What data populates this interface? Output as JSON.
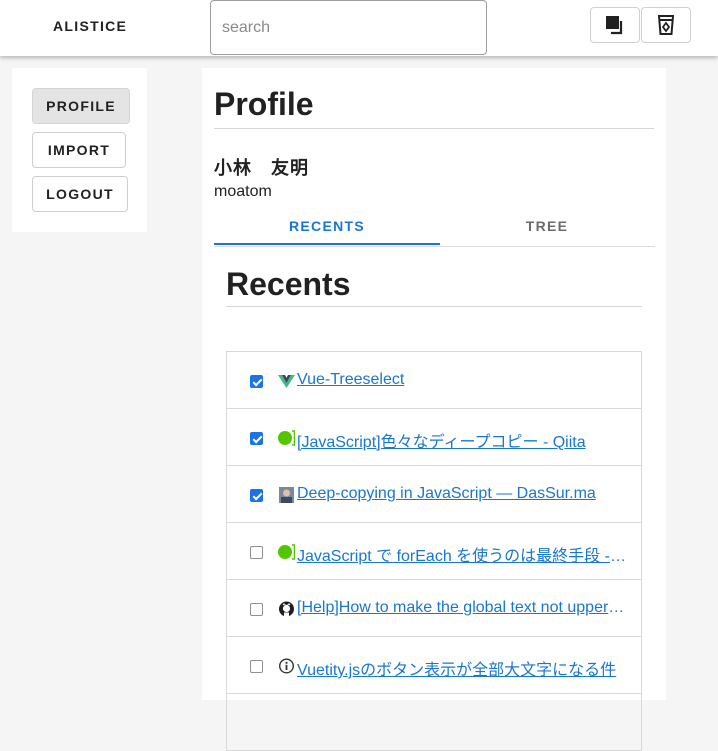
{
  "header": {
    "brand": "ALISTICE",
    "search": {
      "placeholder": "search",
      "value": ""
    },
    "buttons": [
      {
        "icon": "copy-icon"
      },
      {
        "icon": "trash-icon"
      }
    ]
  },
  "sidebar": {
    "items": [
      {
        "label": "PROFILE",
        "active": true
      },
      {
        "label": "IMPORT",
        "active": false
      },
      {
        "label": "LOGOUT",
        "active": false
      }
    ]
  },
  "profile": {
    "title": "Profile",
    "name": "小林　友明",
    "username": "moatom"
  },
  "tabs": [
    {
      "label": "RECENTS",
      "active": true
    },
    {
      "label": "TREE",
      "active": false
    }
  ],
  "recents": {
    "title": "Recents",
    "items": [
      {
        "checked": true,
        "favicon": "vue-icon",
        "text": " Vue-Treeselect"
      },
      {
        "checked": true,
        "favicon": "qiita-icon",
        "text": " [JavaScript]色々なディープコピー - Qiita"
      },
      {
        "checked": true,
        "favicon": "avatar-icon",
        "text": " Deep-copying in JavaScript — DasSur.ma"
      },
      {
        "checked": false,
        "favicon": "qiita-icon",
        "text": " JavaScript で forEach を使うのは最終手段 - Qiita"
      },
      {
        "checked": false,
        "favicon": "github-icon",
        "text": " [Help]How to make the global text not uppercase"
      },
      {
        "checked": false,
        "favicon": "info-icon",
        "text": " Vuetity.jsのボタン表示が全部大文字になる件"
      }
    ]
  },
  "colors": {
    "accent": "#1976d2",
    "checkbox": "#1a73e8",
    "qiita": "#55c500",
    "vue": "#41b883"
  }
}
